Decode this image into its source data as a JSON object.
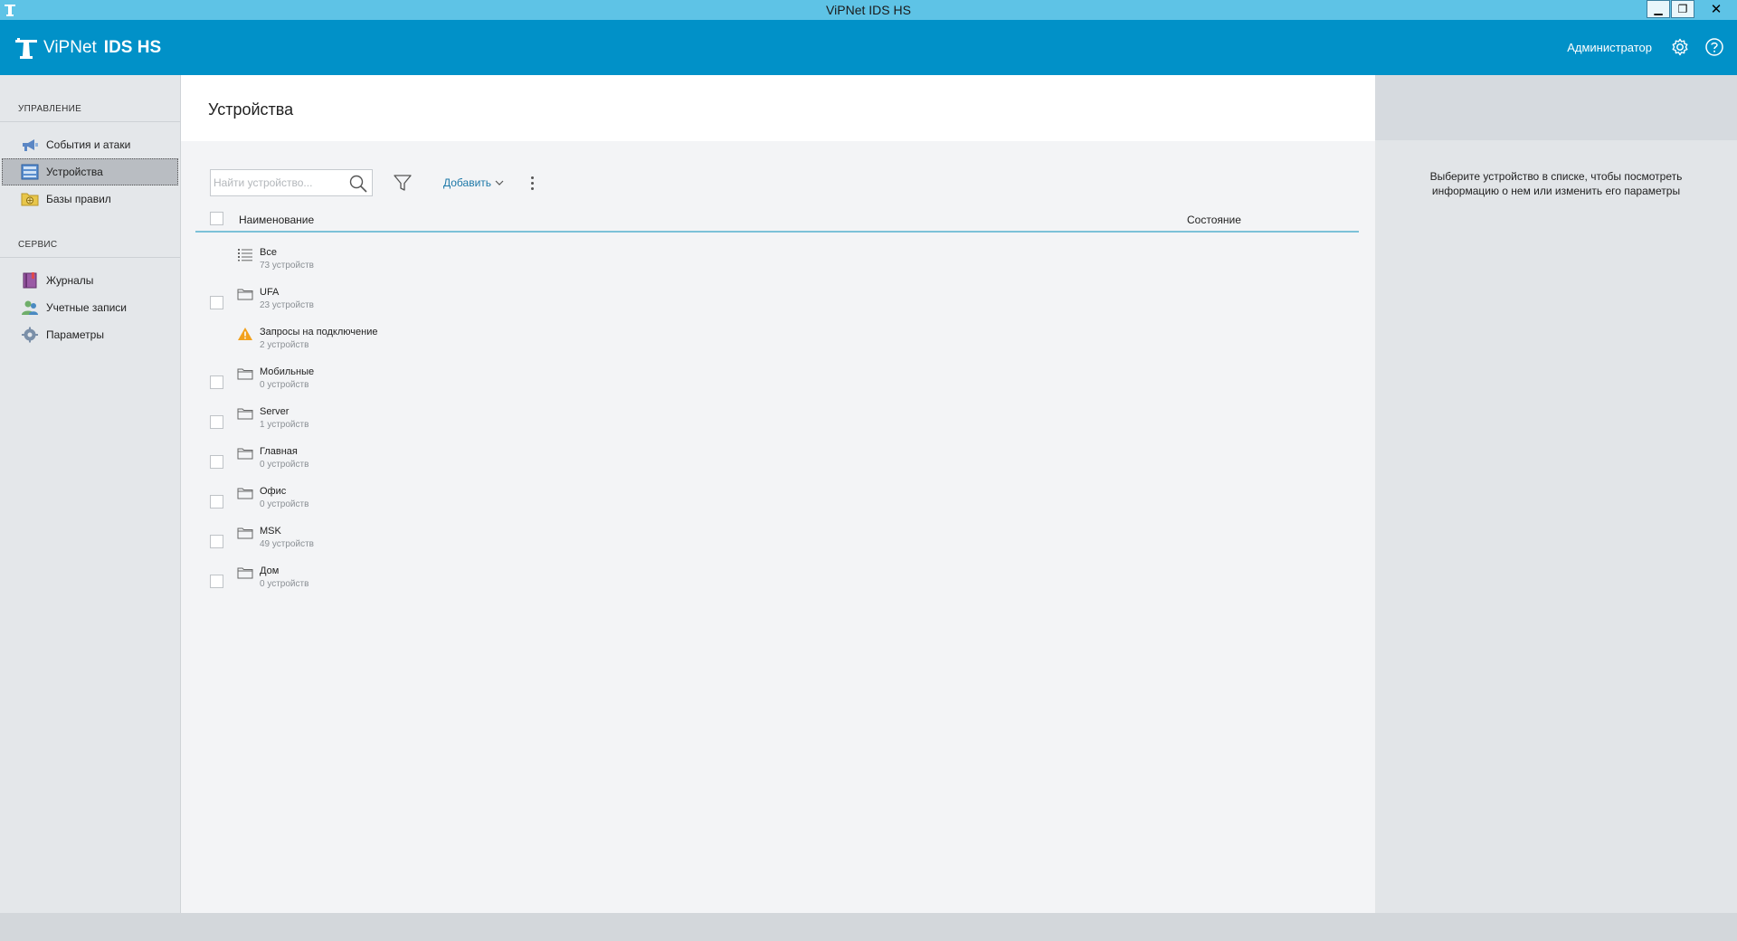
{
  "window": {
    "title": "ViPNet IDS HS",
    "controls": {
      "minimize": "▁",
      "maximize": "❐",
      "close": "✕"
    }
  },
  "header": {
    "brand": "ViPNet",
    "product": "IDS HS",
    "user": "Администратор",
    "icons": [
      "settings-icon",
      "help-icon"
    ]
  },
  "sidebar": {
    "sections": [
      {
        "label": "УПРАВЛЕНИЕ",
        "items": [
          {
            "label": "События и атаки",
            "icon": "megaphone-icon"
          },
          {
            "label": "Устройства",
            "icon": "devices-icon",
            "active": true
          },
          {
            "label": "Базы правил",
            "icon": "rules-folder-icon"
          }
        ]
      },
      {
        "label": "СЕРВИС",
        "items": [
          {
            "label": "Журналы",
            "icon": "journal-icon"
          },
          {
            "label": "Учетные записи",
            "icon": "users-icon"
          },
          {
            "label": "Параметры",
            "icon": "gear-icon"
          }
        ]
      }
    ]
  },
  "main": {
    "title": "Устройства",
    "search": {
      "placeholder": "Найти устройство...",
      "value": ""
    },
    "add_label": "Добавить",
    "columns": {
      "name": "Наименование",
      "state": "Состояние"
    },
    "rows": [
      {
        "name": "Все",
        "count": "73 устройств",
        "icon": "list-icon",
        "checkbox": false
      },
      {
        "name": "UFA",
        "count": "23 устройств",
        "icon": "folder-icon",
        "checkbox": true
      },
      {
        "name": "Запросы на подключение",
        "count": "2 устройств",
        "icon": "warning-icon",
        "checkbox": false
      },
      {
        "name": "Мобильные",
        "count": "0 устройств",
        "icon": "folder-icon",
        "checkbox": true
      },
      {
        "name": "Server",
        "count": "1 устройств",
        "icon": "folder-icon",
        "checkbox": true
      },
      {
        "name": "Главная",
        "count": "0 устройств",
        "icon": "folder-icon",
        "checkbox": true
      },
      {
        "name": "Офис",
        "count": "0 устройств",
        "icon": "folder-icon",
        "checkbox": true
      },
      {
        "name": "MSK",
        "count": "49 устройств",
        "icon": "folder-icon",
        "checkbox": true
      },
      {
        "name": "Дом",
        "count": "0 устройств",
        "icon": "folder-icon",
        "checkbox": true
      }
    ]
  },
  "detail": {
    "message": "Выберите устройство в списке, чтобы посмотреть информацию о нем или изменить его параметры"
  },
  "colors": {
    "titlebar": "#5ec3e6",
    "header": "#0191c8",
    "accent_link": "#1d78a8",
    "header_underline": "#7cc1d8"
  }
}
